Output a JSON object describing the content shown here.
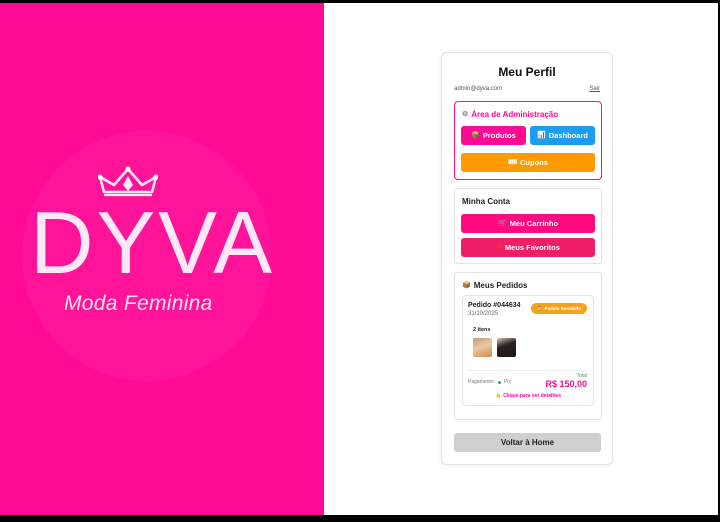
{
  "brand": {
    "logo_text": "DYVA",
    "tagline": "Moda Feminina",
    "background_color": "#ff0a95"
  },
  "profile": {
    "title": "Meu Perfil",
    "email": "admin@dyva.com",
    "logout_label": "Sair"
  },
  "admin": {
    "title": "Área de Administração",
    "icon": "gear-icon",
    "products_label": "Produtos",
    "dashboard_label": "Dashboard",
    "coupons_label": "Cupons",
    "colors": {
      "products": "#ff0a95",
      "dashboard": "#1e9cf0",
      "coupons": "#ff9a00"
    }
  },
  "account": {
    "title": "Minha Conta",
    "cart_label": "Meu Carrinho",
    "favorites_label": "Meus Favoritos",
    "colors": {
      "cart": "#ff0a7f",
      "favorites": "#ee1f67"
    }
  },
  "orders": {
    "title": "Meus Pedidos",
    "icon": "box-icon",
    "items": [
      {
        "number": "Pedido #044634",
        "date": "31/10/2025",
        "status": "Pedido Recebido",
        "status_color": "#f7a21b",
        "item_count": "2 itens",
        "payment_label": "Pagamento:",
        "payment_method": "Pix",
        "total_label": "Total",
        "total": "R$ 150,00",
        "details_label": "Clique para ver detalhes"
      }
    ]
  },
  "home_button_label": "Voltar à Home"
}
